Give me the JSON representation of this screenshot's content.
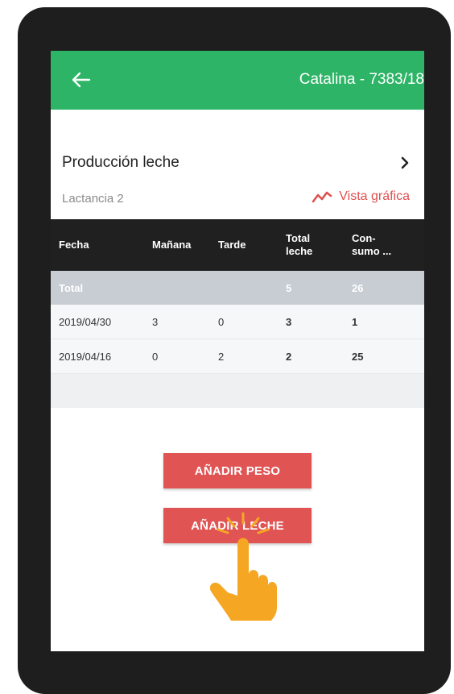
{
  "header": {
    "title": "Catalina - 7383/18"
  },
  "section": {
    "title": "Producción leche",
    "subtitle": "Lactancia 2",
    "chart_link": "Vista gráfica"
  },
  "table": {
    "columns": [
      "Fecha",
      "Mañana",
      "Tarde",
      "Total\nleche",
      "Con-\nsumo ..."
    ],
    "total": {
      "label": "Total",
      "total_leche": "5",
      "consumo": "26"
    },
    "rows": [
      {
        "fecha": "2019/04/30",
        "manana": "3",
        "tarde": "0",
        "total_leche": "3",
        "consumo": "1"
      },
      {
        "fecha": "2019/04/16",
        "manana": "0",
        "tarde": "2",
        "total_leche": "2",
        "consumo": "25"
      }
    ]
  },
  "actions": {
    "add_weight": "AÑADIR PESO",
    "add_milk": "AÑADIR LECHE"
  },
  "colors": {
    "appbar": "#2db466",
    "accent": "#e05454",
    "table_header": "#202020",
    "hand": "#f5a623"
  },
  "icons": {
    "back": "back-arrow-icon",
    "chevron": "chevron-right-icon",
    "chart": "trend-line-icon",
    "hand": "tap-hand-icon"
  }
}
